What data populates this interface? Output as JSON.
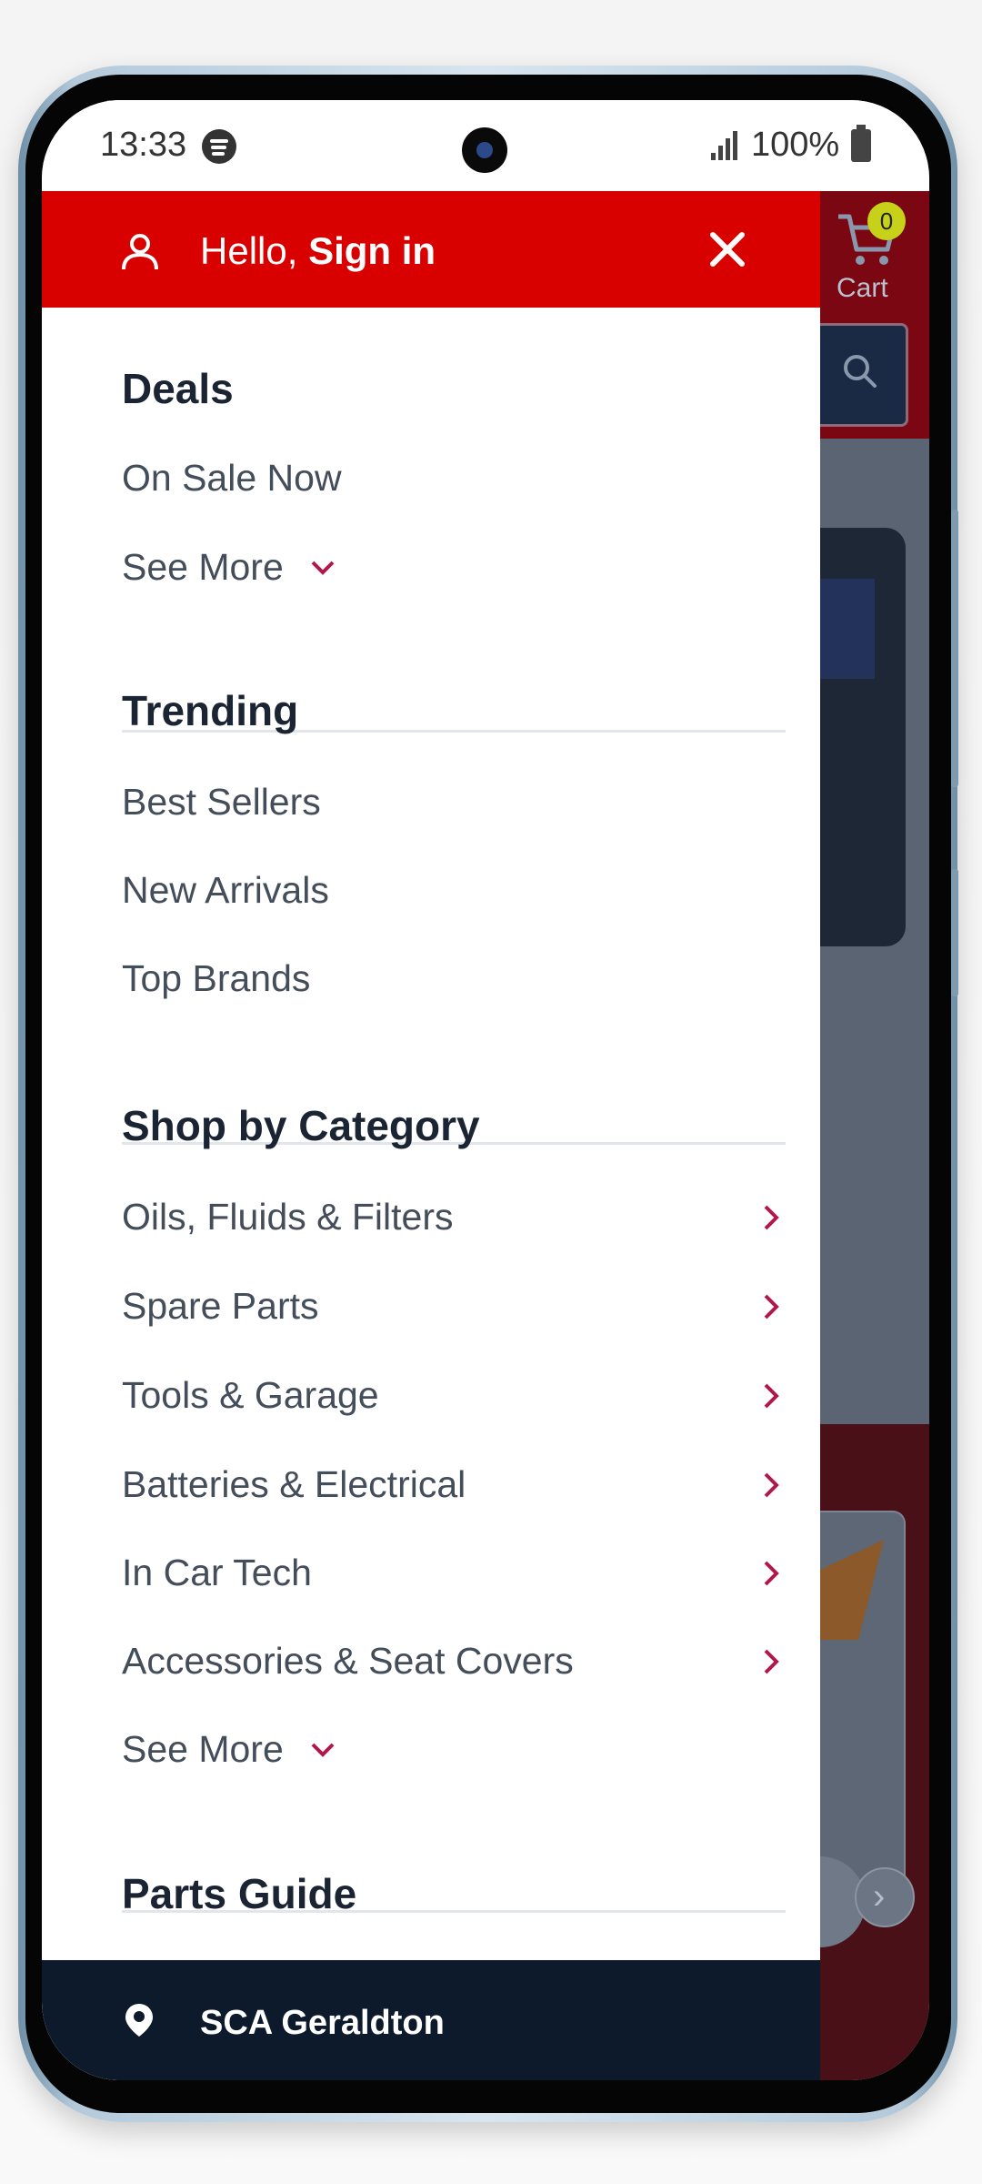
{
  "status_bar": {
    "time": "13:33",
    "battery": "100%"
  },
  "drawer": {
    "greeting_prefix": "Hello,",
    "greeting_action": "Sign in",
    "sections": {
      "deals": {
        "title": "Deals",
        "on_sale": "On Sale Now",
        "see_more": "See More"
      },
      "trending": {
        "title": "Trending",
        "best_sellers": "Best Sellers",
        "new_arrivals": "New Arrivals",
        "top_brands": "Top Brands"
      },
      "category": {
        "title": "Shop by Category",
        "items": [
          "Oils, Fluids & Filters",
          "Spare Parts",
          "Tools & Garage",
          "Batteries & Electrical",
          "In Car Tech",
          "Accessories & Seat Covers"
        ],
        "see_more": "See More"
      },
      "parts_guide": {
        "title": "Parts Guide"
      }
    },
    "store": "SCA Geraldton"
  },
  "background_app": {
    "cart_count": "0",
    "cart_label": "Cart"
  },
  "colors": {
    "header_red": "#d90000",
    "footer_navy": "#0c1a2c",
    "chevron": "#b0174a",
    "title_text": "#1b2433",
    "item_text": "#444d5a"
  },
  "icons": [
    "user-icon",
    "close-icon",
    "chevron-down-icon",
    "chevron-right-icon",
    "location-pin-icon",
    "cart-icon",
    "search-icon",
    "spotify-icon",
    "signal-icon",
    "battery-icon"
  ]
}
